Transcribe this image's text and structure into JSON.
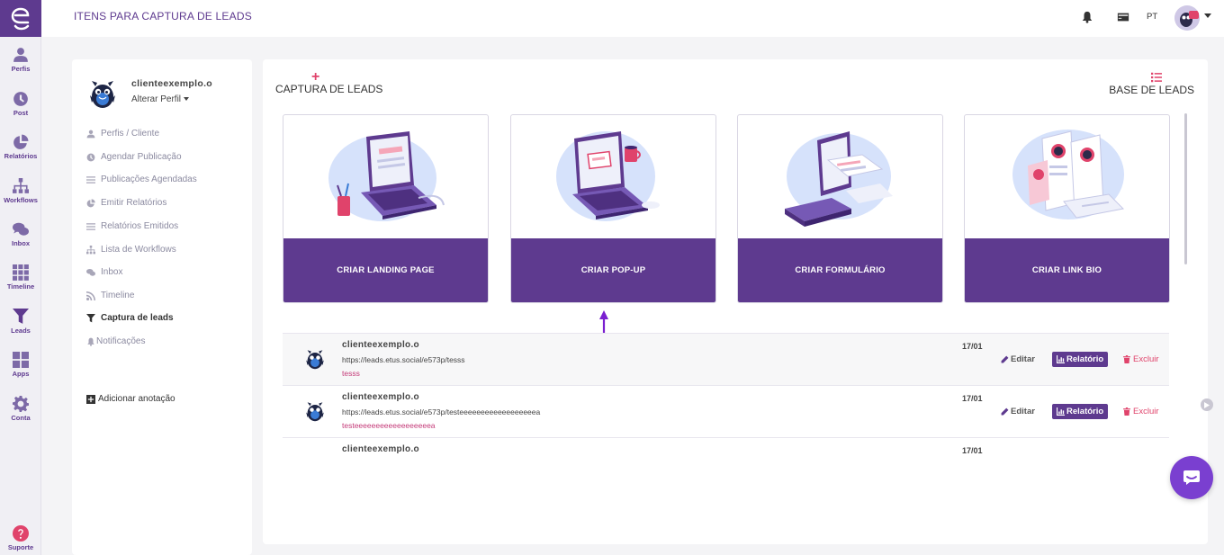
{
  "header": {
    "title": "ITENS PARA CAPTURA DE LEADS",
    "language": "PT"
  },
  "rail": {
    "items": [
      {
        "label": "Perfis",
        "icon": "user-icon"
      },
      {
        "label": "Post",
        "icon": "clock-icon"
      },
      {
        "label": "Relatórios",
        "icon": "pie-chart-icon"
      },
      {
        "label": "Workflows",
        "icon": "sitemap-icon"
      },
      {
        "label": "Inbox",
        "icon": "chat-icon"
      },
      {
        "label": "Timeline",
        "icon": "grid-icon"
      },
      {
        "label": "Leads",
        "icon": "filter-icon"
      },
      {
        "label": "Apps",
        "icon": "apps-icon"
      },
      {
        "label": "Conta",
        "icon": "gear-icon"
      }
    ],
    "support_label": "Suporte"
  },
  "profile": {
    "name": "clienteexemplo.o",
    "change_label": "Alterar Perfil",
    "menu": [
      {
        "label": "Perfis / Cliente",
        "icon": "user-icon"
      },
      {
        "label": "Agendar Publicação",
        "icon": "clock-icon"
      },
      {
        "label": "Publicações Agendadas",
        "icon": "list-icon"
      },
      {
        "label": "Emitir Relatórios",
        "icon": "pie-chart-icon"
      },
      {
        "label": "Relatórios Emitidos",
        "icon": "list-icon"
      },
      {
        "label": "Lista de Workflows",
        "icon": "sitemap-icon"
      },
      {
        "label": "Inbox",
        "icon": "chat-icon"
      },
      {
        "label": "Timeline",
        "icon": "rss-icon"
      },
      {
        "label": "Captura de leads",
        "icon": "filter-icon"
      },
      {
        "label": "Notificações",
        "icon": "bell-icon"
      }
    ],
    "add_note_label": "Adicionar anotação"
  },
  "main": {
    "capture_label": "CAPTURA DE LEADS",
    "base_label": "BASE DE LEADS",
    "cards": [
      {
        "label": "CRIAR LANDING PAGE"
      },
      {
        "label": "CRIAR POP-UP"
      },
      {
        "label": "CRIAR FORMULÁRIO"
      },
      {
        "label": "CRIAR LINK BIO"
      }
    ],
    "rows": [
      {
        "name": "clienteexemplo.o",
        "url": "https://leads.etus.social/e573p/tesss",
        "slug": "tesss",
        "date": "17/01",
        "edit": "Editar",
        "report": "Relatório",
        "delete": "Excluir"
      },
      {
        "name": "clienteexemplo.o",
        "url": "https://leads.etus.social/e573p/testeeeeeeeeeeeeeeeeeea",
        "slug": "testeeeeeeeeeeeeeeeeeea",
        "date": "17/01",
        "edit": "Editar",
        "report": "Relatório",
        "delete": "Excluir"
      },
      {
        "name": "clienteexemplo.o",
        "url": "",
        "slug": "",
        "date": "17/01",
        "edit": "",
        "report": "",
        "delete": ""
      }
    ]
  },
  "colors": {
    "brand_purple": "#5e3a8f",
    "accent_pink": "#e0436b",
    "chat_purple": "#7a3fd0"
  }
}
